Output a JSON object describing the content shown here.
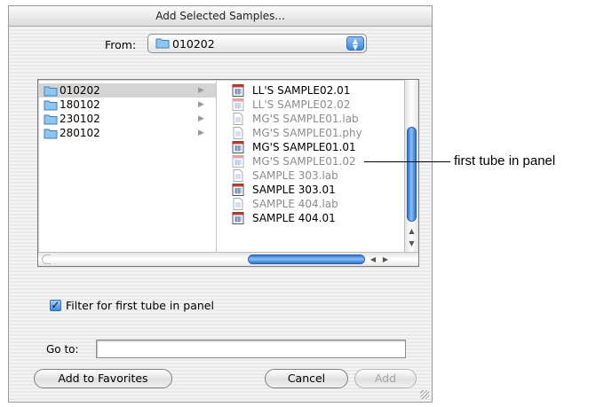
{
  "dialog": {
    "title": "Add Selected Samples...",
    "from": {
      "label": "From:",
      "selected": "010202"
    },
    "folders": [
      {
        "name": "010202",
        "selected": true
      },
      {
        "name": "180102",
        "selected": false
      },
      {
        "name": "230102",
        "selected": false
      },
      {
        "name": "280102",
        "selected": false
      }
    ],
    "files": [
      {
        "name": "LL'S SAMPLE02.01",
        "enabled": true
      },
      {
        "name": "LL'S SAMPLE02.02",
        "enabled": false
      },
      {
        "name": "MG'S SAMPLE01.lab",
        "enabled": false
      },
      {
        "name": "MG'S SAMPLE01.phy",
        "enabled": false
      },
      {
        "name": "MG'S SAMPLE01.01",
        "enabled": true
      },
      {
        "name": "MG'S SAMPLE01.02",
        "enabled": false
      },
      {
        "name": "SAMPLE 303.lab",
        "enabled": false
      },
      {
        "name": "SAMPLE 303.01",
        "enabled": true
      },
      {
        "name": "SAMPLE 404.lab",
        "enabled": false
      },
      {
        "name": "SAMPLE 404.01",
        "enabled": true
      }
    ],
    "filter": {
      "label": "Filter for first tube in panel",
      "checked": true
    },
    "goto": {
      "label": "Go to:",
      "value": ""
    },
    "buttons": {
      "favorites": "Add to Favorites",
      "cancel": "Cancel",
      "add": "Add"
    }
  },
  "callout": {
    "text": "first tube in panel"
  },
  "colors": {
    "accent": "#3a86d8",
    "selection": "#d4d4d4",
    "disabled_text": "#8c8c8c"
  }
}
